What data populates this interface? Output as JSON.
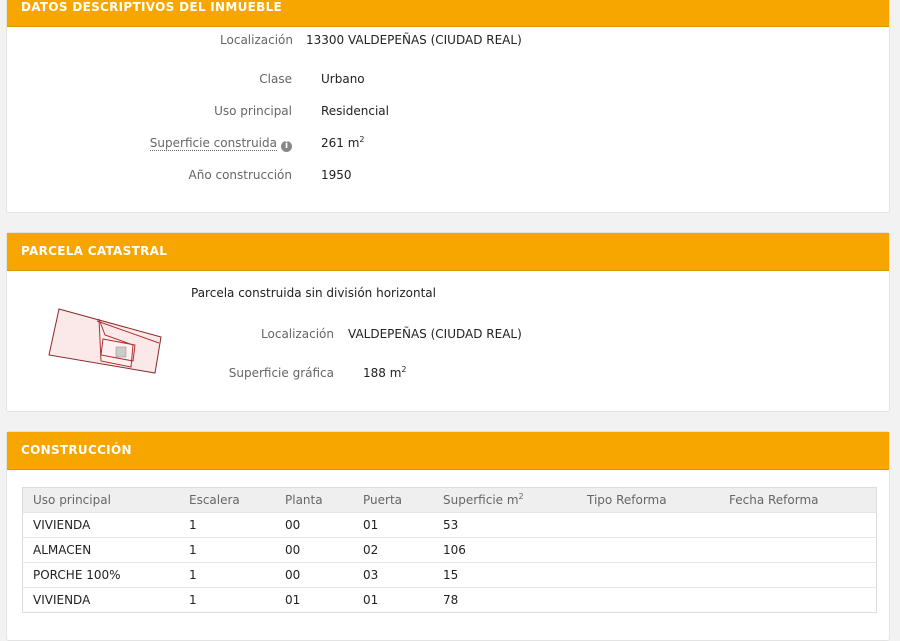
{
  "datos": {
    "header": "DATOS DESCRIPTIVOS DEL INMUEBLE",
    "localizacion_label": "Localización",
    "localizacion_value": "13300 VALDEPEÑAS (CIUDAD REAL)",
    "clase_label": "Clase",
    "clase_value": "Urbano",
    "uso_label": "Uso principal",
    "uso_value": "Residencial",
    "superficie_label": "Superficie construida",
    "superficie_value": "261 m",
    "superficie_sup": "2",
    "info_icon": "info-icon",
    "anio_label": "Año construcción",
    "anio_value": "1950"
  },
  "parcela": {
    "header": "PARCELA CATASTRAL",
    "descripcion": "Parcela construida sin división horizontal",
    "localizacion_label": "Localización",
    "localizacion_value": "VALDEPEÑAS (CIUDAD REAL)",
    "superficie_label": "Superficie gráfica",
    "superficie_value": "188 m",
    "superficie_sup": "2"
  },
  "construccion": {
    "header": "CONSTRUCCIÓN",
    "columns": [
      "Uso principal",
      "Escalera",
      "Planta",
      "Puerta",
      "Superficie m",
      "Tipo Reforma",
      "Fecha Reforma"
    ],
    "superficie_sup": "2",
    "rows": [
      [
        "VIVIENDA",
        "1",
        "00",
        "01",
        "53",
        "",
        ""
      ],
      [
        "ALMACEN",
        "1",
        "00",
        "02",
        "106",
        "",
        ""
      ],
      [
        "PORCHE 100%",
        "1",
        "00",
        "03",
        "15",
        "",
        ""
      ],
      [
        "VIVIENDA",
        "1",
        "01",
        "01",
        "78",
        "",
        ""
      ]
    ]
  }
}
